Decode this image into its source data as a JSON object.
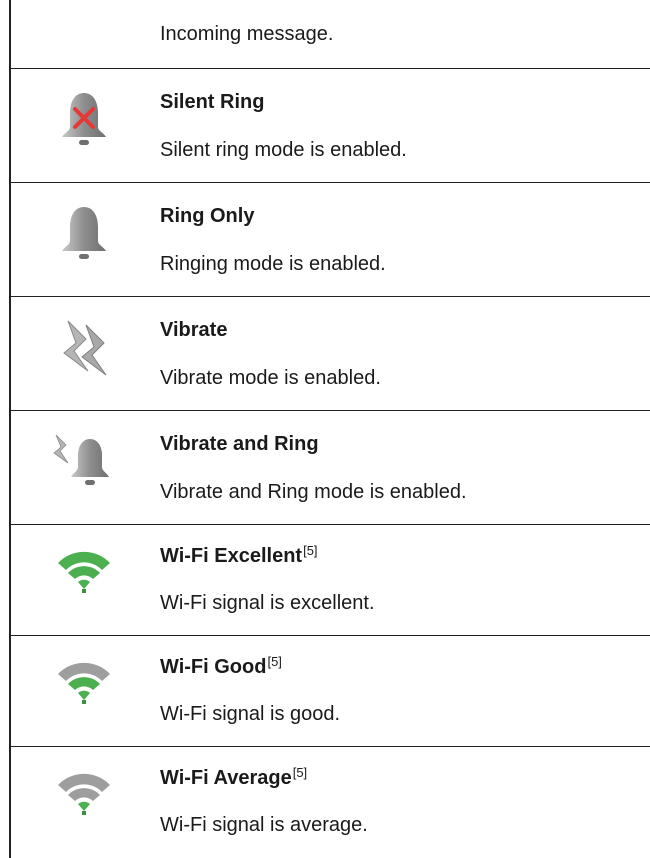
{
  "partial_row": {
    "description": "Incoming message."
  },
  "rows": [
    {
      "icon": "silent-ring-icon",
      "title": "Silent Ring",
      "sup": "",
      "description": "Silent ring mode is enabled."
    },
    {
      "icon": "ring-only-icon",
      "title": "Ring Only",
      "sup": "",
      "description": "Ringing mode is enabled."
    },
    {
      "icon": "vibrate-icon",
      "title": "Vibrate",
      "sup": "",
      "description": "Vibrate mode is enabled."
    },
    {
      "icon": "vibrate-and-ring-icon",
      "title": "Vibrate and Ring",
      "sup": "",
      "description": "Vibrate and Ring mode is enabled."
    },
    {
      "icon": "wifi-excellent-icon",
      "title": "Wi-Fi Excellent",
      "sup": "[5]",
      "description": "Wi-Fi signal is excellent."
    },
    {
      "icon": "wifi-good-icon",
      "title": "Wi-Fi Good",
      "sup": "[5]",
      "description": "Wi-Fi signal is good."
    },
    {
      "icon": "wifi-average-icon",
      "title": "Wi-Fi Average",
      "sup": "[5]",
      "description": "Wi-Fi signal is average."
    }
  ],
  "colors": {
    "wifi_active": "#4caf50",
    "wifi_inactive": "#9e9e9e",
    "bell": "#9a9a9a",
    "cross": "#e53935"
  }
}
